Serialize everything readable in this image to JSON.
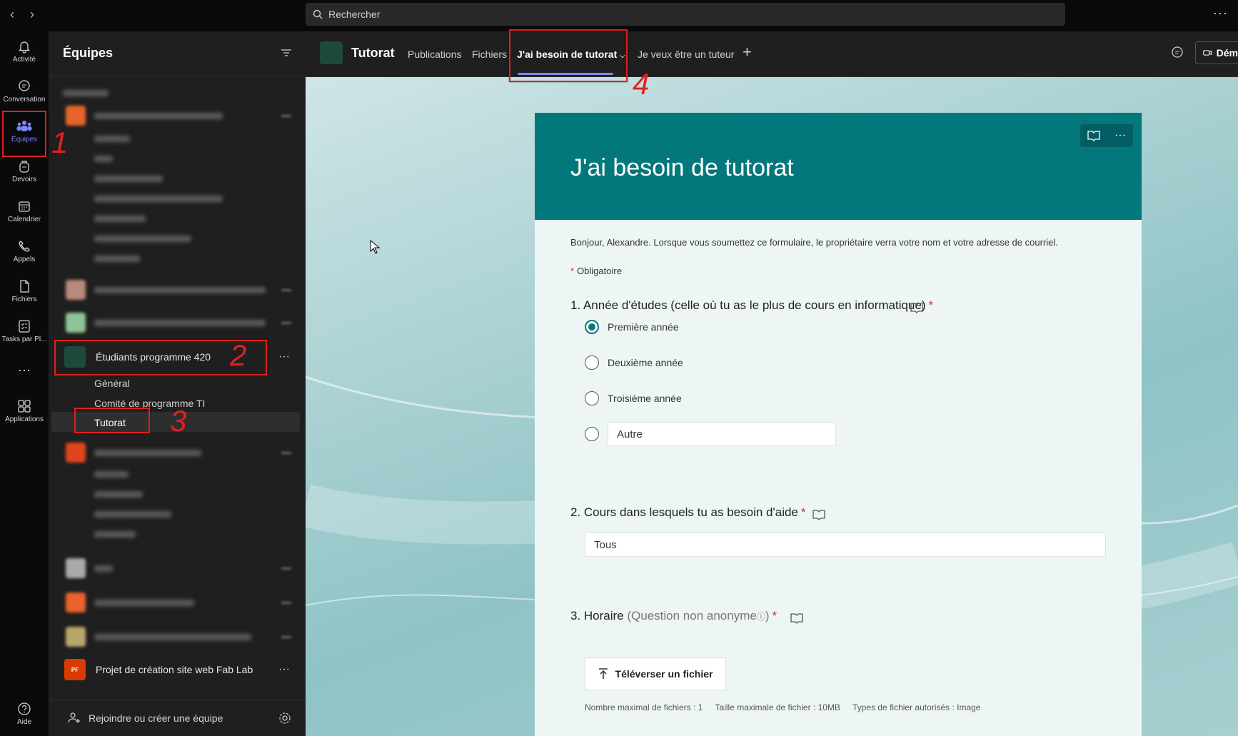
{
  "topbar": {
    "search_placeholder": "Rechercher",
    "more": "···"
  },
  "rail": [
    {
      "label": "Activité",
      "icon": "bell-icon"
    },
    {
      "label": "Conversation",
      "icon": "chat-icon"
    },
    {
      "label": "Équipes",
      "icon": "teams-icon",
      "active": true
    },
    {
      "label": "Devoirs",
      "icon": "backpack-icon"
    },
    {
      "label": "Calendrier",
      "icon": "calendar-icon"
    },
    {
      "label": "Appels",
      "icon": "phone-icon"
    },
    {
      "label": "Fichiers",
      "icon": "file-icon"
    },
    {
      "label": "Tasks par Pl...",
      "icon": "tasks-icon"
    },
    {
      "label": "Applications",
      "icon": "apps-icon"
    },
    {
      "label": "Aide",
      "icon": "help-icon"
    }
  ],
  "rail_more": "···",
  "panel": {
    "title": "Équipes",
    "team_420": "Étudiants programme 420",
    "channels": [
      "Général",
      "Comité de programme TI",
      "Tutorat"
    ],
    "team_fablab": "Projet de création site web Fab Lab",
    "team_fablab_initials": "PF",
    "footer": "Rejoindre ou créer une équipe",
    "more": "···"
  },
  "tabs": {
    "title": "Tutorat",
    "items": [
      "Publications",
      "Fichiers",
      "J'ai besoin de tutorat",
      "Je veux être un tuteur"
    ],
    "add": "+",
    "meet": "Dém"
  },
  "form": {
    "title": "J'ai besoin de tutorat",
    "intro": "Bonjour, Alexandre. Lorsque vous soumettez ce formulaire, le propriétaire verra votre nom et votre adresse de courriel.",
    "required_star": "*",
    "required_label": "Obligatoire",
    "q1": {
      "title": "1. Année d'études (celle où tu as le plus de cours en informatique)",
      "options": [
        "Première année",
        "Deuxième année",
        "Troisième année"
      ],
      "other_placeholder": "Autre",
      "selected": 0
    },
    "q2": {
      "title": "2. Cours dans lesquels tu as besoin d'aide",
      "value": "Tous"
    },
    "q3": {
      "title": "3. Horaire",
      "note": "(Question non anonyme",
      "note_end": ")"
    },
    "upload_label": "Téléverser un fichier",
    "upload_info": [
      "Nombre maximal de fichiers : 1",
      "Taille maximale de fichier : 10MB",
      "Types de fichier autorisés : Image"
    ],
    "tools_more": "···"
  },
  "annotations": [
    "1",
    "2",
    "3",
    "4"
  ],
  "colors": {
    "accent": "#7f85f5",
    "form_header": "#03787c",
    "annotation": "#e02020",
    "required": "#c4314b"
  }
}
